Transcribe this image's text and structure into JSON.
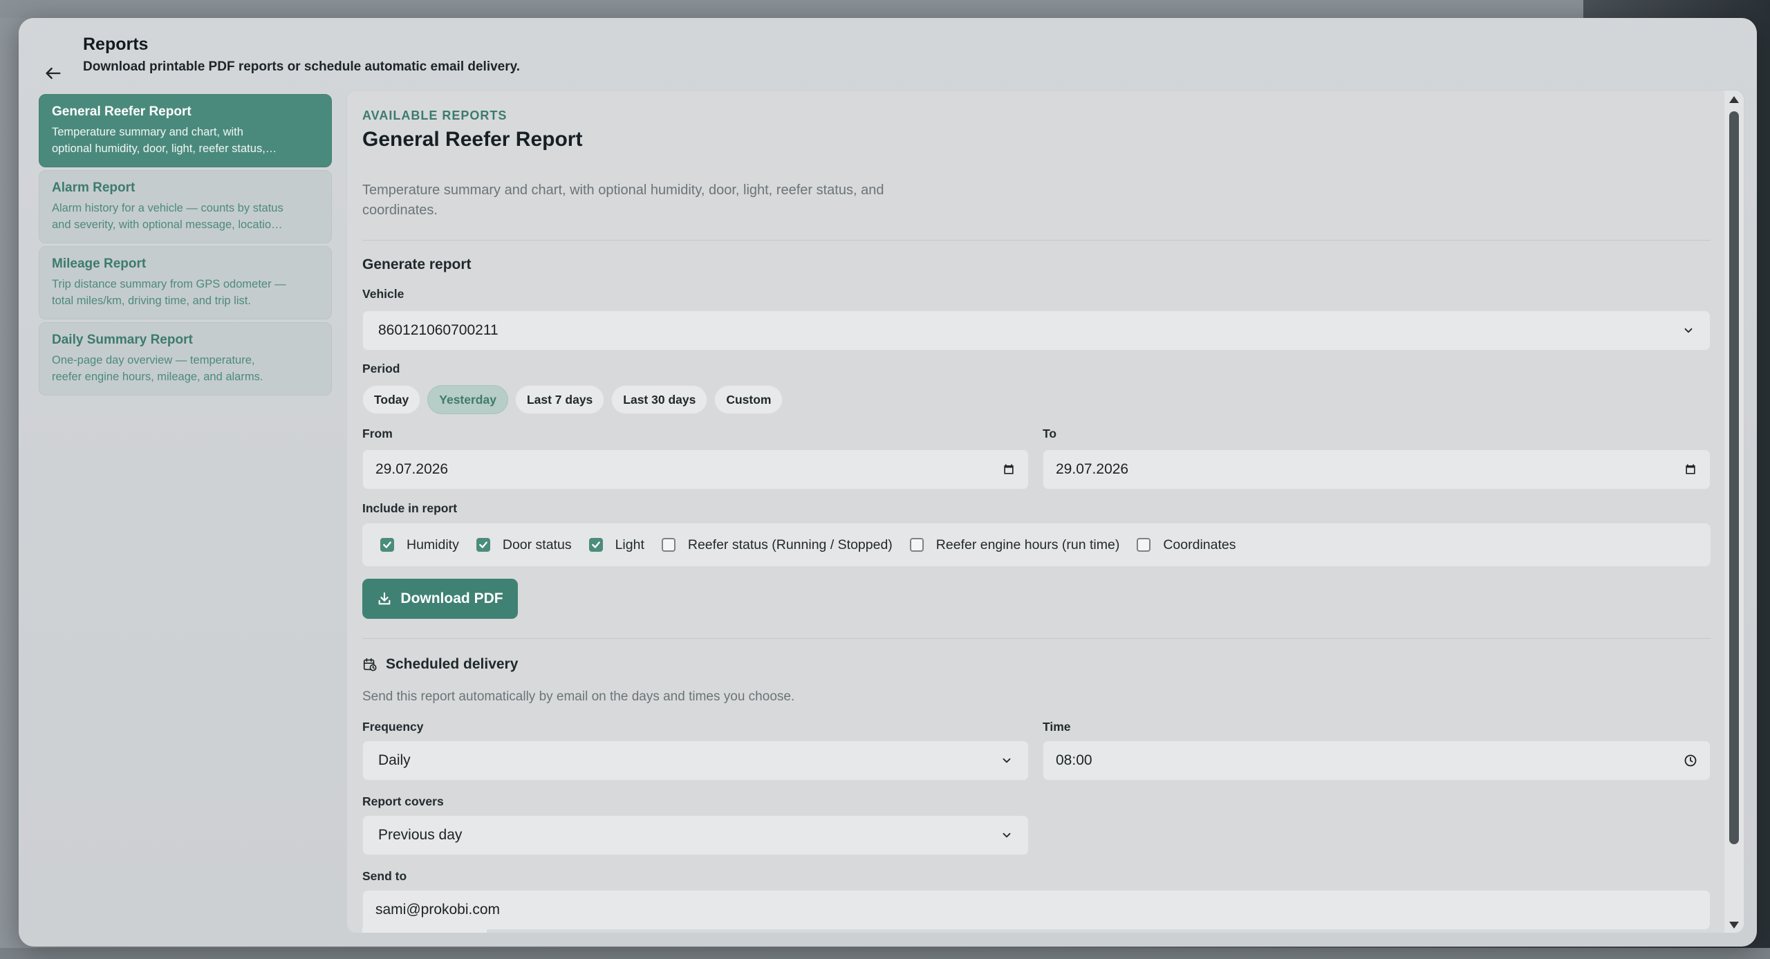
{
  "header": {
    "title": "Reports",
    "subtitle": "Download printable PDF reports or schedule automatic email delivery."
  },
  "sidebar": {
    "items": [
      {
        "title": "General Reefer Report",
        "desc_line1": "Temperature summary and chart, with",
        "desc_line2": "optional humidity, door, light, reefer status,…",
        "active": true
      },
      {
        "title": "Alarm Report",
        "desc_line1": "Alarm history for a vehicle — counts by status",
        "desc_line2": "and severity, with optional message, locatio…",
        "active": false
      },
      {
        "title": "Mileage Report",
        "desc_line1": "Trip distance summary from GPS odometer —",
        "desc_line2": "total miles/km, driving time, and trip list.",
        "active": false
      },
      {
        "title": "Daily Summary Report",
        "desc_line1": "One-page day overview — temperature,",
        "desc_line2": "reefer engine hours, mileage, and alarms.",
        "active": false
      }
    ]
  },
  "main": {
    "eyebrow": "AVAILABLE REPORTS",
    "title": "General Reefer Report",
    "desc_line1": "Temperature summary and chart, with optional humidity, door, light, reefer status, and",
    "desc_line2": "coordinates.",
    "generate": {
      "section_title": "Generate report",
      "vehicle_label": "Vehicle",
      "vehicle_value": "860121060700211",
      "period_label": "Period",
      "period_options": [
        "Today",
        "Yesterday",
        "Last 7 days",
        "Last 30 days",
        "Custom"
      ],
      "period_selected": "Yesterday",
      "from_label": "From",
      "from_value": "29.07.2026",
      "to_label": "To",
      "to_value": "29.07.2026",
      "include_label": "Include in report",
      "include_options": [
        {
          "label": "Humidity",
          "checked": true
        },
        {
          "label": "Door status",
          "checked": true
        },
        {
          "label": "Light",
          "checked": true
        },
        {
          "label": "Reefer status (Running / Stopped)",
          "checked": false
        },
        {
          "label": "Reefer engine hours (run time)",
          "checked": false
        },
        {
          "label": "Coordinates",
          "checked": false
        }
      ],
      "download_label": "Download PDF"
    },
    "schedule": {
      "section_title": "Scheduled delivery",
      "desc": "Send this report automatically by email on the days and times you choose.",
      "frequency_label": "Frequency",
      "frequency_value": "Daily",
      "time_label": "Time",
      "time_value": "08:00",
      "covers_label": "Report covers",
      "covers_value": "Previous day",
      "sendto_label": "Send to",
      "sendto_value": "sami@prokobi.com"
    }
  },
  "colors": {
    "accent": "#3f8273",
    "accent_light": "#b7cdc7",
    "active_card": "#4a8a7c"
  }
}
